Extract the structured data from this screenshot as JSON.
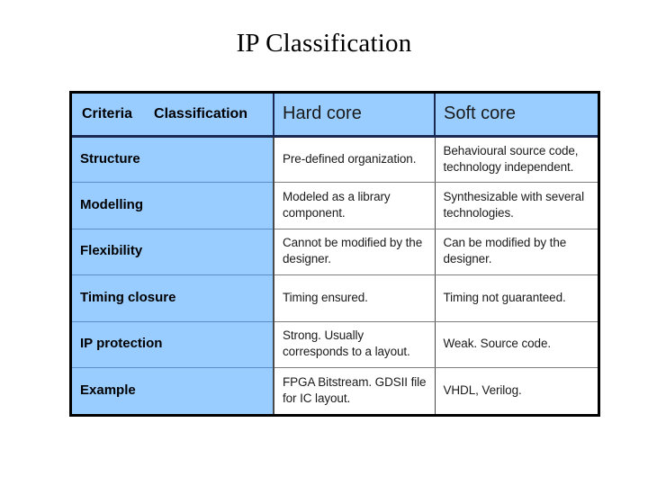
{
  "slide": {
    "title": "IP Classification"
  },
  "table": {
    "header": {
      "criteria_label": "Criteria",
      "classification_label": "Classification",
      "columns": [
        {
          "label": "Hard core"
        },
        {
          "label": "Soft core"
        }
      ]
    },
    "rows": [
      {
        "criteria": "Structure",
        "hard_core": "Pre-defined organization.",
        "soft_core": "Behavioural source code, technology independent."
      },
      {
        "criteria": "Modelling",
        "hard_core": "Modeled as a library component.",
        "soft_core": "Synthesizable with several technologies."
      },
      {
        "criteria": "Flexibility",
        "hard_core": "Cannot be modified by the designer.",
        "soft_core": "Can be modified by the designer."
      },
      {
        "criteria": "Timing closure",
        "hard_core": "Timing ensured.",
        "soft_core": "Timing not guaranteed."
      },
      {
        "criteria": "IP protection",
        "hard_core": "Strong. Usually corresponds to a layout.",
        "soft_core": "Weak. Source code."
      },
      {
        "criteria": "Example",
        "hard_core": "FPGA Bitstream. GDSII file for IC layout.",
        "soft_core": "VHDL, Verilog."
      }
    ]
  },
  "colors": {
    "header_blue": "#99ccff",
    "criteria_blue": "#99ccff",
    "table_border": "#000000",
    "header_divider": "#1a2a52",
    "cell_divider": "#7d7d7d",
    "text": "#000000",
    "background": "#ffffff"
  }
}
